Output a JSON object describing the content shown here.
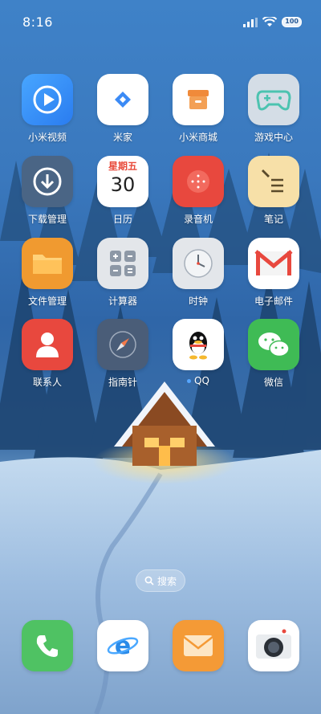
{
  "status_bar": {
    "time": "8:16",
    "battery": "100"
  },
  "apps": [
    {
      "label": "小米视频",
      "icon": "video-icon"
    },
    {
      "label": "米家",
      "icon": "mijia-icon"
    },
    {
      "label": "小米商城",
      "icon": "store-icon"
    },
    {
      "label": "游戏中心",
      "icon": "gamepad-icon"
    },
    {
      "label": "下载管理",
      "icon": "download-icon"
    },
    {
      "label": "日历",
      "icon": "calendar-icon",
      "calendar_month": "星期五",
      "calendar_day": "30"
    },
    {
      "label": "录音机",
      "icon": "recorder-icon"
    },
    {
      "label": "笔记",
      "icon": "notes-icon"
    },
    {
      "label": "文件管理",
      "icon": "folder-icon"
    },
    {
      "label": "计算器",
      "icon": "calculator-icon"
    },
    {
      "label": "时钟",
      "icon": "clock-icon"
    },
    {
      "label": "电子邮件",
      "icon": "email-icon"
    },
    {
      "label": "联系人",
      "icon": "contacts-icon"
    },
    {
      "label": "指南针",
      "icon": "compass-icon"
    },
    {
      "label": "QQ",
      "icon": "qq-icon"
    },
    {
      "label": "微信",
      "icon": "wechat-icon"
    }
  ],
  "search": {
    "label": "搜索"
  },
  "dock": [
    {
      "icon": "phone-icon"
    },
    {
      "icon": "browser-icon"
    },
    {
      "icon": "messages-icon"
    },
    {
      "icon": "camera-icon"
    }
  ],
  "colors": {
    "sky_top": "#3f82c8",
    "snow": "#a9c8e6",
    "accent_blue": "#3b8af5",
    "notification_dot": "#56a6ff"
  }
}
